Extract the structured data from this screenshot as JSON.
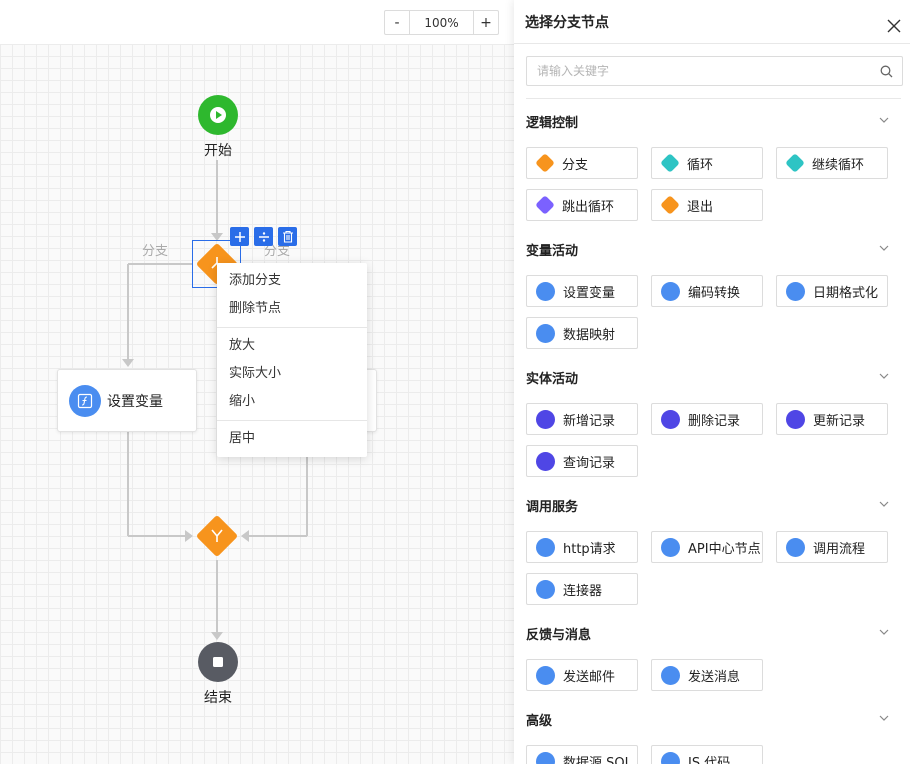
{
  "toolbar": {
    "zoom_out": "-",
    "zoom_value": "100%",
    "zoom_in": "+"
  },
  "flow": {
    "start_label": "开始",
    "end_label": "结束",
    "branch_left_label": "分支",
    "branch_right_label": "分支",
    "card_left_label": "设置变量"
  },
  "context_menu": {
    "add_branch": "添加分支",
    "delete_node": "删除节点",
    "zoom_in": "放大",
    "actual_size": "实际大小",
    "zoom_out": "缩小",
    "center": "居中"
  },
  "panel": {
    "title": "选择分支节点",
    "search_placeholder": "请输入关键字",
    "sections": [
      {
        "title": "逻辑控制",
        "items": [
          "分支",
          "循环",
          "继续循环",
          "跳出循环",
          "退出"
        ]
      },
      {
        "title": "变量活动",
        "items": [
          "设置变量",
          "编码转换",
          "日期格式化",
          "数据映射"
        ]
      },
      {
        "title": "实体活动",
        "items": [
          "新增记录",
          "删除记录",
          "更新记录",
          "查询记录"
        ]
      },
      {
        "title": "调用服务",
        "items": [
          "http请求",
          "API中心节点",
          "调用流程",
          "连接器"
        ]
      },
      {
        "title": "反馈与消息",
        "items": [
          "发送邮件",
          "发送消息"
        ]
      },
      {
        "title": "高级",
        "items": [
          "数据源 SQL",
          "JS 代码"
        ]
      }
    ]
  },
  "colors": {
    "start": "#2eb82e",
    "end": "#585b63",
    "branch": "#f7941d",
    "accent": "#2a6de8",
    "teal": "#2ec4c4",
    "purple": "#7b61ff",
    "indigo": "#4f46e5",
    "service_blue": "#4a8df0"
  },
  "icons": {
    "start": "play-icon",
    "end": "stop-icon",
    "branch": "branch-icon",
    "close": "close-icon",
    "search": "search-icon",
    "section_toggle": "chevron-down-icon"
  }
}
